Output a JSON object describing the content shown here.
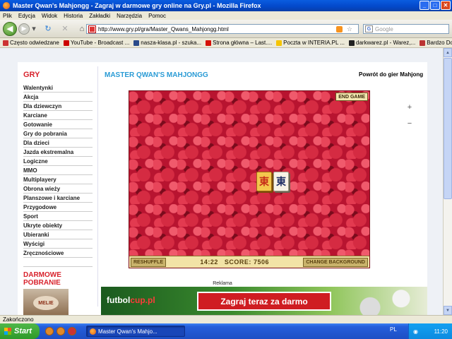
{
  "window": {
    "title": "Master Qwan's Mahjongg - Zagraj w darmowe gry online na Gry.pl - Mozilla Firefox"
  },
  "menu": [
    "Plik",
    "Edycja",
    "Widok",
    "Historia",
    "Zakładki",
    "Narzędzia",
    "Pomoc"
  ],
  "navbar": {
    "url": "http://www.gry.pl/gra/Master_Qwans_Mahjongg.html",
    "search_placeholder": "Google"
  },
  "bookmarks": [
    {
      "label": "Często odwiedzane",
      "color": "#c33"
    },
    {
      "label": "YouTube - Broadcast ...",
      "color": "#c00"
    },
    {
      "label": "nasza-klasa.pl - szuka...",
      "color": "#2a4a8a"
    },
    {
      "label": "Strona główna – Last....",
      "color": "#d51007"
    },
    {
      "label": "Poczta w INTERIA.PL ...",
      "color": "#f5c400"
    },
    {
      "label": "darkwarez.pl - Warez,...",
      "color": "#222"
    },
    {
      "label": "Bardzo Dobry dermat...",
      "color": "#b33"
    }
  ],
  "sidebar": {
    "heading": "GRY",
    "items": [
      "Walentynki",
      "Akcja",
      "Dla dziewczyn",
      "Karciane",
      "Gotowanie",
      "Gry do pobrania",
      "Dla dzieci",
      "Jazda ekstremalna",
      "Logiczne",
      "MMO",
      "Multiplayery",
      "Obrona wieży",
      "Planszowe i karciane",
      "Przygodowe",
      "Sport",
      "Ukryte obiekty",
      "Ubieranki",
      "Wyścigi",
      "Zręcznościowe"
    ],
    "download_heading_1": "DARMOWE",
    "download_heading_2": "POBRANIE",
    "download_image_text": "MELIE"
  },
  "main": {
    "game_title": "MASTER QWAN'S MAHJONGG",
    "back_link": "Powrót do gier Mahjong",
    "zoom_in_icon": "+",
    "zoom_out_icon": "−"
  },
  "game": {
    "end_game": "END GAME",
    "tiles": [
      "東",
      "東"
    ],
    "reshuffle": "RESHUFFLE",
    "time": "14:22",
    "score_label": "SCORE:",
    "score": "7506",
    "change_background": "CHANGE BACKGROUND"
  },
  "ad": {
    "label": "Reklama",
    "logo_main": "futbol",
    "logo_accent": "cup.pl",
    "cta": "Zagraj teraz za darmo"
  },
  "status": {
    "text": "Zakończono"
  },
  "taskbar": {
    "start": "Start",
    "task": "Master Qwan's Mahjo...",
    "lang": "PL",
    "clock": "11:20"
  }
}
